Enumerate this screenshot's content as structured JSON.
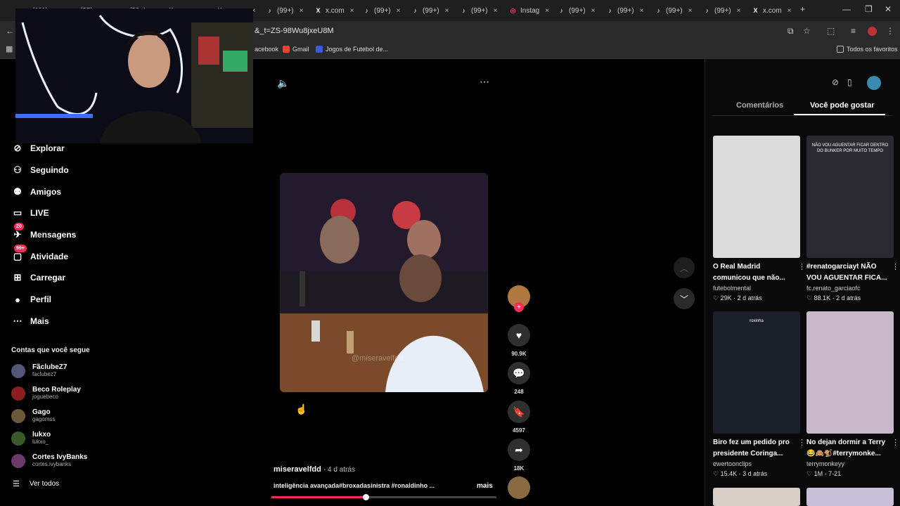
{
  "browser": {
    "tabs": [
      {
        "label": "(111)",
        "icon": "youtube-icon"
      },
      {
        "label": "(25)",
        "icon": "youtube-icon"
      },
      {
        "label": "(99+)",
        "icon": "tiktok-icon"
      },
      {
        "label": "x.com",
        "icon": "x-icon"
      },
      {
        "label": "x.com",
        "icon": "x-icon"
      },
      {
        "label": "(99+)",
        "icon": "tiktok-icon"
      },
      {
        "label": "x.com",
        "icon": "x-icon"
      },
      {
        "label": "(99+)",
        "icon": "tiktok-icon"
      },
      {
        "label": "(99+)",
        "icon": "tiktok-icon"
      },
      {
        "label": "(99+)",
        "icon": "tiktok-icon"
      },
      {
        "label": "Instag",
        "icon": "instagram-icon"
      },
      {
        "label": "(99+)",
        "icon": "tiktok-icon"
      },
      {
        "label": "(99+)",
        "icon": "tiktok-icon"
      },
      {
        "label": "(99+)",
        "icon": "tiktok-icon"
      },
      {
        "label": "(99+)",
        "icon": "tiktok-icon"
      },
      {
        "label": "x.com",
        "icon": "x-icon"
      }
    ],
    "url": "&_t=ZS-98Wu8jxeU8M",
    "bookmarks": [
      {
        "label": "acebook",
        "color": "#1877f2"
      },
      {
        "label": "Gmail",
        "color": "#ea4335"
      },
      {
        "label": "Jogos de Futebol de...",
        "color": "#3b5bdb"
      }
    ],
    "all_bookmarks": "Todos os favoritos"
  },
  "sidebar": {
    "nav": [
      {
        "label": "Explorar",
        "icon": "compass-icon"
      },
      {
        "label": "Seguindo",
        "icon": "following-icon"
      },
      {
        "label": "Amigos",
        "icon": "friends-icon"
      },
      {
        "label": "LIVE",
        "icon": "live-icon"
      },
      {
        "label": "Mensagens",
        "icon": "messages-icon",
        "badge": "20"
      },
      {
        "label": "Atividade",
        "icon": "activity-icon",
        "badge": "99+"
      },
      {
        "label": "Carregar",
        "icon": "upload-icon"
      },
      {
        "label": "Perfil",
        "icon": "profile-icon"
      },
      {
        "label": "Mais",
        "icon": "more-icon"
      }
    ],
    "following_title": "Contas que você segue",
    "following": [
      {
        "name": "FãclubeZ7",
        "handle": "faclubez7",
        "color": "#555577"
      },
      {
        "name": "Beco Roleplay",
        "handle": "joguebeco",
        "color": "#8a1f1f"
      },
      {
        "name": "Gago",
        "handle": "gagomss",
        "color": "#6b5a3a"
      },
      {
        "name": "lukxo",
        "handle": "lukxo_",
        "color": "#3a5a2a"
      },
      {
        "name": "Cortes IvyBanks",
        "handle": "cortes.ivybanks",
        "color": "#6a3a6a"
      }
    ],
    "see_all": "Ver todos"
  },
  "player": {
    "author": "miseravelfdd",
    "time_ago": "· 4 d atrás",
    "caption": "inteligência avançada#broxadasinistra #ronaldinho ...",
    "more": "mais",
    "watermark": "@miseravelfdd",
    "progress": 0.42,
    "likes": "90.9K",
    "comments": "248",
    "saves": "4597",
    "shares": "18K"
  },
  "right_panel": {
    "tabs": [
      "Comentários",
      "Você pode gostar"
    ],
    "active_tab": 1,
    "cards": [
      {
        "title": "O Real Madrid comunicou que não...",
        "author": "futebolmental",
        "likes": "29K",
        "time": "2 d atrás",
        "thumb_color": "#dcdcdc"
      },
      {
        "title": "#renatogarciayt NÃO VOU AGUENTAR FICA...",
        "author": "fc.renato_garciaofc",
        "likes": "88.1K",
        "time": "2 d atrás",
        "thumb_color": "#2a2a30",
        "thumb_text": "NÃO VOU AGUENTAR FICAR DENTRO DO BUNKER POR MUITO TEMPO"
      },
      {
        "title": "Biro fez um pedido pro presidente Coringa...",
        "author": "ewertoonclips",
        "likes": "15.4K",
        "time": "3 d atrás",
        "thumb_color": "#1a1f2a",
        "thumb_text": "roxinha"
      },
      {
        "title": "No dejan dormir a Terry 😂🙈🐒#terrymonke...",
        "author": "terrymonkeyy",
        "likes": "1M",
        "time": "7-21",
        "thumb_color": "#c8b8c8"
      }
    ]
  },
  "colors": {
    "accent": "#fe2c55",
    "bg": "#000000"
  }
}
